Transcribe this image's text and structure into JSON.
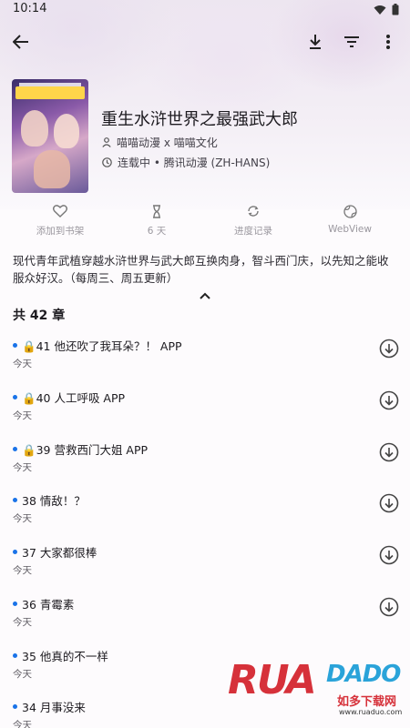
{
  "status_bar": {
    "time": "10:14"
  },
  "manga": {
    "title": "重生水浒世界之最强武大郎",
    "author": "喵喵动漫 x 喵喵文化",
    "status": "连载中 • 腾讯动漫 (ZH-HANS)",
    "description": "现代青年武植穿越水浒世界与武大郎互换肉身，智斗西门庆，以先知之能收服众好汉。（每周三、周五更新）"
  },
  "actions": [
    {
      "label": "添加到书架",
      "icon": "heart-icon"
    },
    {
      "label": "6 天",
      "icon": "hourglass-icon"
    },
    {
      "label": "进度记录",
      "icon": "sync-icon"
    },
    {
      "label": "WebView",
      "icon": "globe-icon"
    }
  ],
  "chapter_count": "共 42 章",
  "chapters": [
    {
      "title": "🔒41 他还吹了我耳朵？！ APP",
      "date": "今天"
    },
    {
      "title": "🔒40 人工呼吸 APP",
      "date": "今天"
    },
    {
      "title": "🔒39 营救西门大姐 APP",
      "date": "今天"
    },
    {
      "title": "38 情敌！？",
      "date": "今天"
    },
    {
      "title": "37 大家都很棒",
      "date": "今天"
    },
    {
      "title": "36 青霉素",
      "date": "今天"
    },
    {
      "title": "35 他真的不一样",
      "date": "今天"
    },
    {
      "title": "34 月事没来",
      "date": "今天"
    }
  ],
  "watermark": {
    "brand_left": "RUA",
    "brand_right": "DADO",
    "cn": "如多下载网",
    "url": "www.ruaduo.com"
  },
  "colors": {
    "accent": "#1a73e8",
    "muted": "#9a979e",
    "watermark_red": "#d6313a",
    "watermark_blue": "#2aa3d9"
  }
}
